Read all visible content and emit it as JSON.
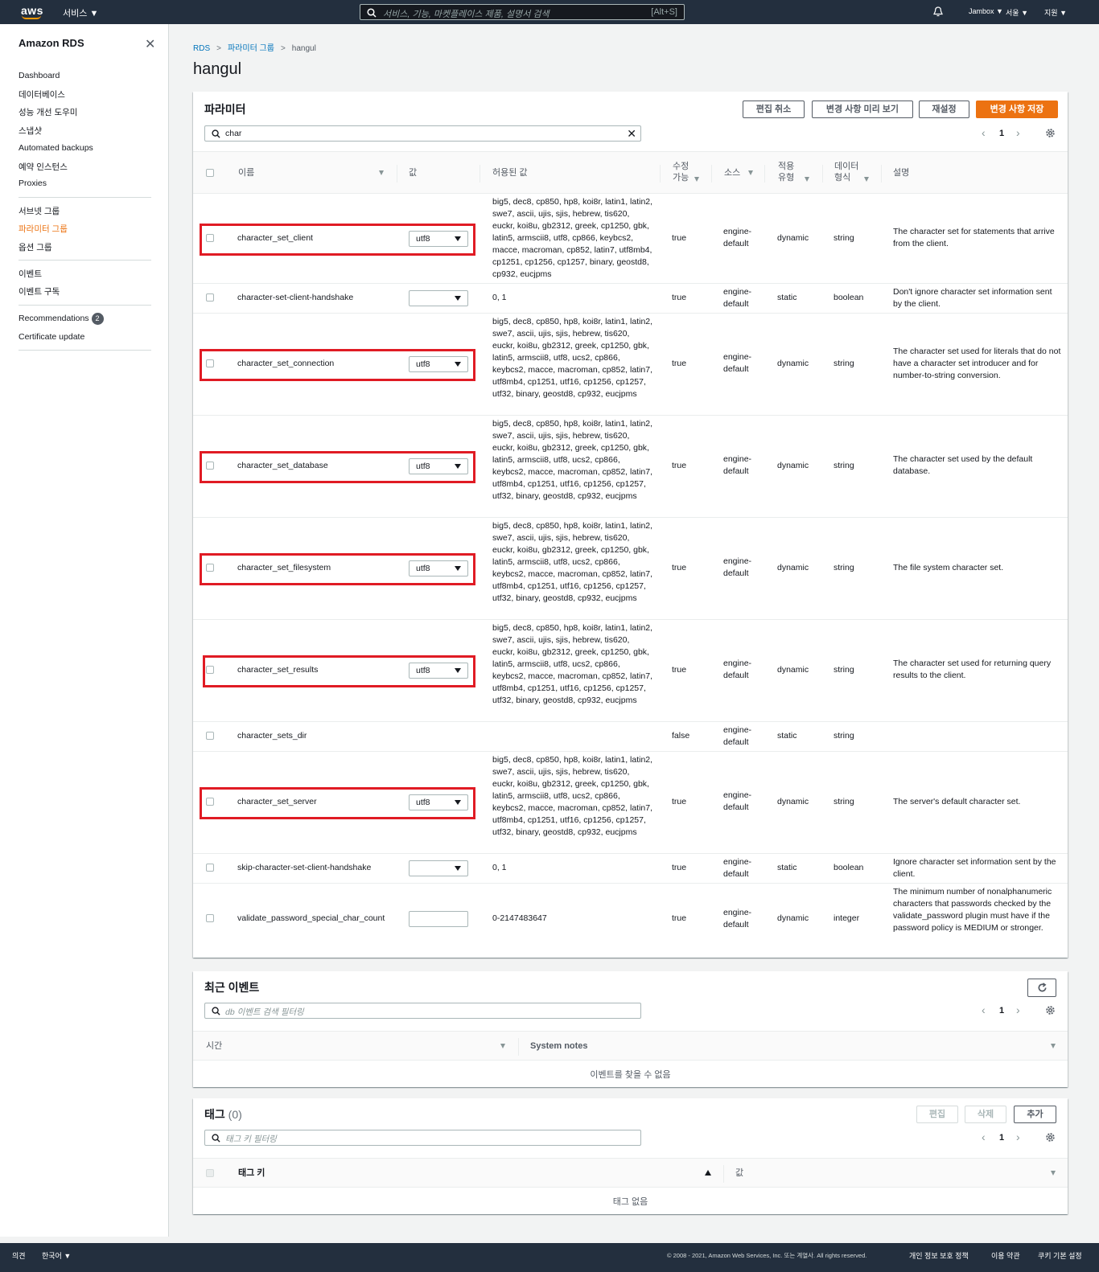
{
  "topbar": {
    "logo": "aws",
    "services_label": "서비스",
    "search_placeholder": "서비스, 기능, 마켓플레이스 제품, 설명서 검색",
    "search_shortcut": "[Alt+S]",
    "account_label": "Jambox",
    "region_label": "서울",
    "support_label": "지원"
  },
  "sidebar": {
    "title": "Amazon RDS",
    "items": [
      {
        "label": "Dashboard"
      },
      {
        "label": "데이터베이스"
      },
      {
        "label": "성능 개선 도우미"
      },
      {
        "label": "스냅샷"
      },
      {
        "label": "Automated backups"
      },
      {
        "label": "예약 인스턴스"
      },
      {
        "label": "Proxies"
      },
      {
        "label": "서브넷 그룹"
      },
      {
        "label": "파라미터 그룹"
      },
      {
        "label": "옵션 그룹"
      },
      {
        "label": "이벤트"
      },
      {
        "label": "이벤트 구독"
      },
      {
        "label": "Recommendations",
        "badge": "2"
      },
      {
        "label": "Certificate update"
      }
    ]
  },
  "breadcrumb": {
    "items": [
      "RDS",
      "파라미터 그룹",
      "hangul"
    ]
  },
  "page_title": "hangul",
  "params": {
    "title": "파라미터",
    "buttons": {
      "cancel": "편집 취소",
      "preview": "변경 사항 미리 보기",
      "reset": "재설정",
      "save": "변경 사항 저장"
    },
    "filter_value": "char",
    "page": "1",
    "columns": {
      "name": "이름",
      "value": "값",
      "allowed": "허용된 값",
      "modifiable": "수정 가능",
      "source": "소스",
      "apply_type": "적용 유형",
      "data_type": "데이터 형식",
      "description": "설명"
    },
    "rows": [
      {
        "name": "character_set_client",
        "value": "utf8",
        "allowed": "big5, dec8, cp850, hp8, koi8r, latin1, latin2, swe7, ascii, ujis, sjis, hebrew, tis620, euckr, koi8u, gb2312, greek, cp1250, gbk, latin5, armscii8, utf8, cp866, keybcs2, macce, macroman, cp852, latin7, utf8mb4, cp1251, cp1256, cp1257, binary, geostd8, cp932, eucjpms",
        "modifiable": "true",
        "source": "engine-default",
        "apply_type": "dynamic",
        "data_type": "string",
        "description": "The character set for statements that arrive from the client."
      },
      {
        "name": "character-set-client-handshake",
        "value": "",
        "allowed": "0, 1",
        "modifiable": "true",
        "source": "engine-default",
        "apply_type": "static",
        "data_type": "boolean",
        "description": "Don't ignore character set information sent by the client."
      },
      {
        "name": "character_set_connection",
        "value": "utf8",
        "allowed": "big5, dec8, cp850, hp8, koi8r, latin1, latin2, swe7, ascii, ujis, sjis, hebrew, tis620, euckr, koi8u, gb2312, greek, cp1250, gbk, latin5, armscii8, utf8, ucs2, cp866, keybcs2, macce, macroman, cp852, latin7, utf8mb4, cp1251, utf16, cp1256, cp1257, utf32, binary, geostd8, cp932, eucjpms",
        "modifiable": "true",
        "source": "engine-default",
        "apply_type": "dynamic",
        "data_type": "string",
        "description": "The character set used for literals that do not have a character set introducer and for number-to-string conversion."
      },
      {
        "name": "character_set_database",
        "value": "utf8",
        "allowed": "big5, dec8, cp850, hp8, koi8r, latin1, latin2, swe7, ascii, ujis, sjis, hebrew, tis620, euckr, koi8u, gb2312, greek, cp1250, gbk, latin5, armscii8, utf8, ucs2, cp866, keybcs2, macce, macroman, cp852, latin7, utf8mb4, cp1251, utf16, cp1256, cp1257, utf32, binary, geostd8, cp932, eucjpms",
        "modifiable": "true",
        "source": "engine-default",
        "apply_type": "dynamic",
        "data_type": "string",
        "description": "The character set used by the default database."
      },
      {
        "name": "character_set_filesystem",
        "value": "utf8",
        "allowed": "big5, dec8, cp850, hp8, koi8r, latin1, latin2, swe7, ascii, ujis, sjis, hebrew, tis620, euckr, koi8u, gb2312, greek, cp1250, gbk, latin5, armscii8, utf8, ucs2, cp866, keybcs2, macce, macroman, cp852, latin7, utf8mb4, cp1251, utf16, cp1256, cp1257, utf32, binary, geostd8, cp932, eucjpms",
        "modifiable": "true",
        "source": "engine-default",
        "apply_type": "dynamic",
        "data_type": "string",
        "description": "The file system character set."
      },
      {
        "name": "character_set_results",
        "value": "utf8",
        "allowed": "big5, dec8, cp850, hp8, koi8r, latin1, latin2, swe7, ascii, ujis, sjis, hebrew, tis620, euckr, koi8u, gb2312, greek, cp1250, gbk, latin5, armscii8, utf8, ucs2, cp866, keybcs2, macce, macroman, cp852, latin7, utf8mb4, cp1251, utf16, cp1256, cp1257, utf32, binary, geostd8, cp932, eucjpms",
        "modifiable": "true",
        "source": "engine-default",
        "apply_type": "dynamic",
        "data_type": "string",
        "description": "The character set used for returning query results to the client."
      },
      {
        "name": "character_sets_dir",
        "value": "",
        "allowed": "",
        "modifiable": "false",
        "source": "engine-default",
        "apply_type": "static",
        "data_type": "string",
        "description": ""
      },
      {
        "name": "character_set_server",
        "value": "utf8",
        "allowed": "big5, dec8, cp850, hp8, koi8r, latin1, latin2, swe7, ascii, ujis, sjis, hebrew, tis620, euckr, koi8u, gb2312, greek, cp1250, gbk, latin5, armscii8, utf8, ucs2, cp866, keybcs2, macce, macroman, cp852, latin7, utf8mb4, cp1251, utf16, cp1256, cp1257, utf32, binary, geostd8, cp932, eucjpms",
        "modifiable": "true",
        "source": "engine-default",
        "apply_type": "dynamic",
        "data_type": "string",
        "description": "The server's default character set."
      },
      {
        "name": "skip-character-set-client-handshake",
        "value": "",
        "allowed": "0, 1",
        "modifiable": "true",
        "source": "engine-default",
        "apply_type": "static",
        "data_type": "boolean",
        "description": "Ignore character set information sent by the client."
      },
      {
        "name": "validate_password_special_char_count",
        "value": "",
        "allowed": "0-2147483647",
        "modifiable": "true",
        "source": "engine-default",
        "apply_type": "dynamic",
        "data_type": "integer",
        "description": "The minimum number of nonalphanumeric characters that passwords checked by the validate_password plugin must have if the password policy is MEDIUM or stronger."
      }
    ]
  },
  "events": {
    "title": "최근 이벤트",
    "filter_placeholder": "db 이벤트 검색 필터링",
    "page": "1",
    "col_time": "시간",
    "col_notes": "System notes",
    "empty": "이벤트를 찾을 수 없음"
  },
  "tags": {
    "title": "태그",
    "count": "(0)",
    "buttons": {
      "edit": "편집",
      "delete": "삭제",
      "add": "추가"
    },
    "filter_placeholder": "태그 키 필터링",
    "page": "1",
    "col_key": "태그 키",
    "col_value": "값",
    "empty": "태그 없음"
  },
  "footer": {
    "feedback": "의견",
    "language": "한국어",
    "copyright": "© 2008 - 2021, Amazon Web Services, Inc. 또는 계열사. All rights reserved.",
    "privacy": "개인 정보 보호 정책",
    "terms": "이용 약관",
    "cookies": "쿠키 기본 설정"
  }
}
